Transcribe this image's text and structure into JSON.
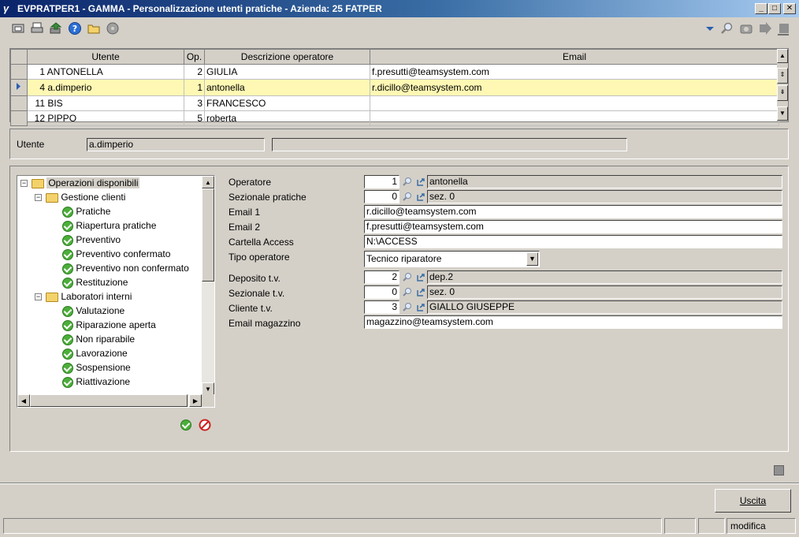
{
  "window": {
    "title": "EVPRATPER1 - GAMMA - Personalizzazione utenti pratiche - Azienda:  25 FATPER",
    "app_glyph": "γ",
    "minimize": "_",
    "maximize": "□",
    "close": "✕"
  },
  "grid": {
    "columns": [
      "",
      "Utente",
      "Op.",
      "Descrizione operatore",
      "Email"
    ],
    "rows": [
      {
        "num": "1",
        "utente": "ANTONELLA",
        "op": "2",
        "descr": "GIULIA",
        "email": "f.presutti@teamsystem.com"
      },
      {
        "num": "4",
        "utente": "a.dimperio",
        "op": "1",
        "descr": "antonella",
        "email": "r.dicillo@teamsystem.com"
      },
      {
        "num": "11",
        "utente": "BIS",
        "op": "3",
        "descr": "FRANCESCO",
        "email": ""
      },
      {
        "num": "12",
        "utente": "PIPPO",
        "op": "5",
        "descr": "roberta",
        "email": ""
      }
    ],
    "selected_row": 1
  },
  "header_panel": {
    "utente_label": "Utente",
    "utente_value": "a.dimperio",
    "utente_desc": ""
  },
  "tree": {
    "root": "Operazioni disponibili",
    "groups": [
      {
        "label": "Gestione clienti",
        "items": [
          "Pratiche",
          "Riapertura pratiche",
          "Preventivo",
          "Preventivo confermato",
          "Preventivo non confermato",
          "Restituzione"
        ]
      },
      {
        "label": "Laboratori interni",
        "items": [
          "Valutazione",
          "Riparazione aperta",
          "Non riparabile",
          "Lavorazione",
          "Sospensione",
          "Riattivazione"
        ]
      }
    ]
  },
  "form": {
    "operatore": {
      "label": "Operatore",
      "code": "1",
      "desc": "antonella"
    },
    "sezionale_pratiche": {
      "label": "Sezionale pratiche",
      "code": "0",
      "desc": "sez. 0"
    },
    "email1": {
      "label": "Email 1",
      "value": "r.dicillo@teamsystem.com"
    },
    "email2": {
      "label": "Email 2",
      "value": "f.presutti@teamsystem.com"
    },
    "cartella_access": {
      "label": "Cartella Access",
      "value": "N:\\ACCESS"
    },
    "tipo_operatore": {
      "label": "Tipo operatore",
      "value": "Tecnico riparatore"
    },
    "deposito_tv": {
      "label": "Deposito t.v.",
      "code": "2",
      "desc": "dep.2"
    },
    "sezionale_tv": {
      "label": "Sezionale t.v.",
      "code": "0",
      "desc": "sez. 0"
    },
    "cliente_tv": {
      "label": "Cliente t.v.",
      "code": "3",
      "desc": "GIALLO GIUSEPPE"
    },
    "email_magazzino": {
      "label": "Email magazzino",
      "value": "magazzino@teamsystem.com"
    }
  },
  "buttons": {
    "uscita": "Uscita"
  },
  "status": {
    "mode": "modifica"
  },
  "colors": {
    "selected_row": "#fff8b4",
    "titlebar": "#0a246a",
    "window_bg": "#d4d0c8"
  }
}
